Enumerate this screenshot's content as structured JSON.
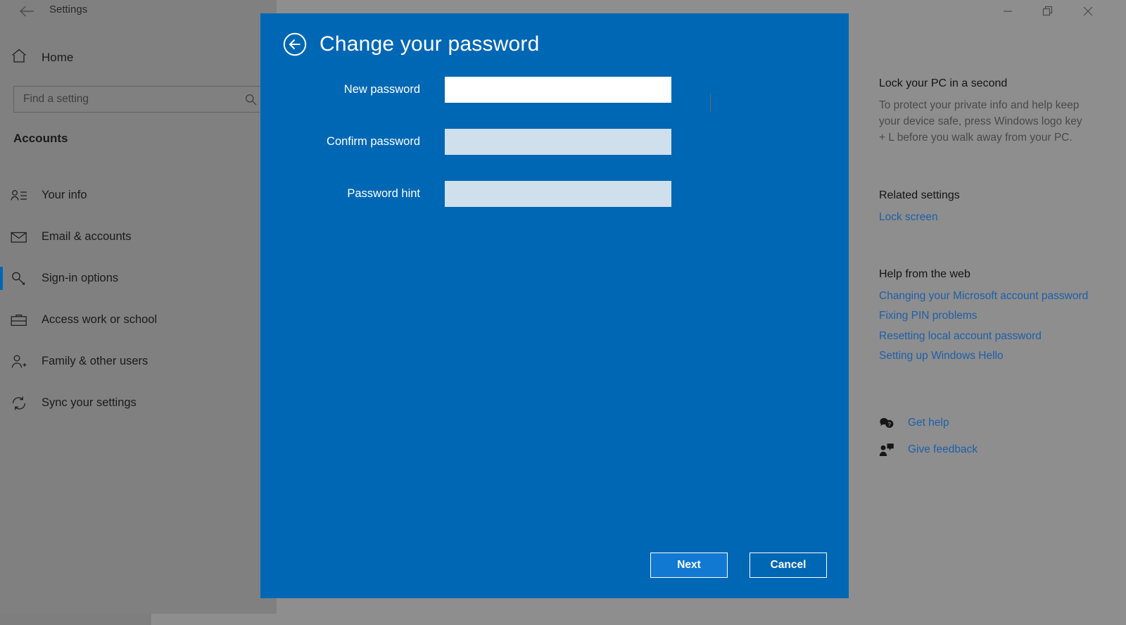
{
  "window": {
    "title": "Settings",
    "back_icon": "arrow-left-icon",
    "controls": {
      "minimize": "—",
      "maximize": "❐",
      "close": "✕"
    }
  },
  "sidebar": {
    "home_label": "Home",
    "home_icon": "home-icon",
    "search": {
      "placeholder": "Find a setting",
      "value": "",
      "icon": "search-icon"
    },
    "section_heading": "Accounts",
    "items": [
      {
        "label": "Your info",
        "icon": "person-list-icon",
        "selected": false
      },
      {
        "label": "Email & accounts",
        "icon": "envelope-icon",
        "selected": false
      },
      {
        "label": "Sign-in options",
        "icon": "key-icon",
        "selected": true
      },
      {
        "label": "Access work or school",
        "icon": "briefcase-icon",
        "selected": false
      },
      {
        "label": "Family & other users",
        "icon": "person-add-icon",
        "selected": false
      },
      {
        "label": "Sync your settings",
        "icon": "sync-icon",
        "selected": false
      }
    ]
  },
  "right_panel": {
    "tip_heading": "Lock your PC in a second",
    "tip_body": "To protect your private info and help keep your device safe, press Windows logo key + L before you walk away from your PC.",
    "related_heading": "Related settings",
    "related_links": [
      "Lock screen"
    ],
    "help_heading": "Help from the web",
    "help_links": [
      "Changing your Microsoft account password",
      "Fixing PIN problems",
      "Resetting local account password",
      "Setting up Windows Hello"
    ],
    "support": [
      {
        "label": "Get help",
        "icon": "help-bubble-icon"
      },
      {
        "label": "Give feedback",
        "icon": "feedback-person-icon"
      }
    ]
  },
  "dialog": {
    "back_icon": "circle-arrow-left-icon",
    "title": "Change your password",
    "fields": [
      {
        "label": "New password",
        "value": "",
        "focused": true
      },
      {
        "label": "Confirm password",
        "value": "",
        "focused": false
      },
      {
        "label": "Password hint",
        "value": "",
        "focused": false
      }
    ],
    "primary_button": "Next",
    "secondary_button": "Cancel"
  },
  "colors": {
    "dialog_blue": "#0067b4",
    "accent_blue": "#0067b8",
    "primary_button_blue": "#1179d2",
    "input_idle": "#cfdfec",
    "link_blue": "#1f5fa8",
    "sidebar_grey": "#808080",
    "panel_grey": "#8e8e8e"
  }
}
